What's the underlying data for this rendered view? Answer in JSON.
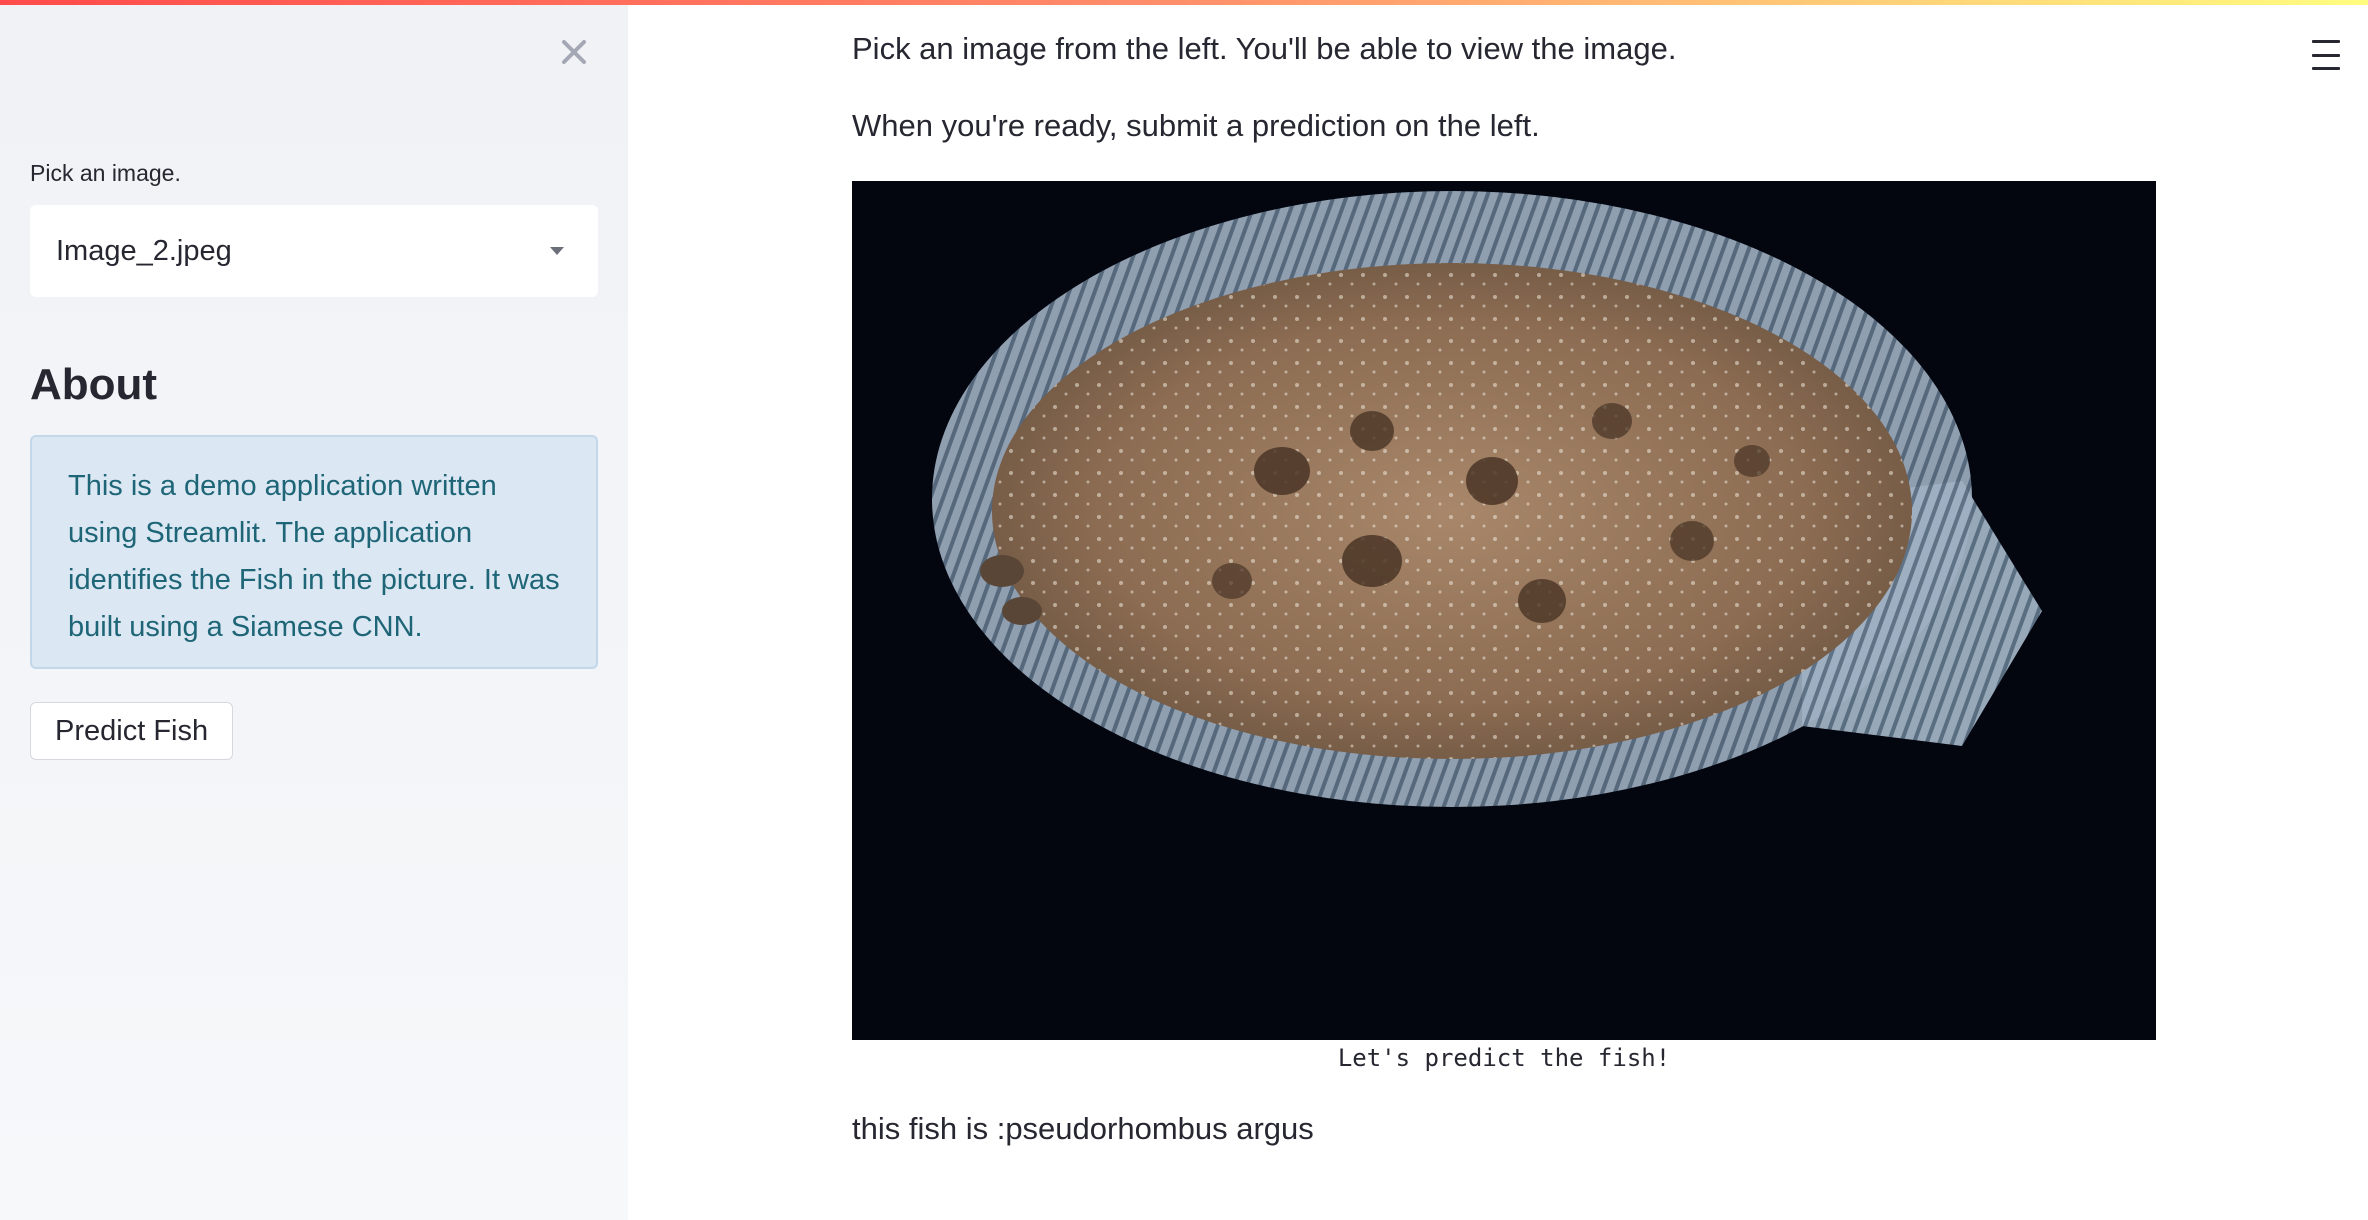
{
  "sidebar": {
    "select_label": "Pick an image.",
    "selected_image": "Image_2.jpeg",
    "about_heading": "About",
    "about_text": "This is a demo application written using Streamlit. The application identifies the Fish in the picture. It was built using a Siamese CNN.",
    "predict_button": "Predict Fish",
    "close_icon": "close-icon"
  },
  "main": {
    "instruction_1": "Pick an image from the left. You'll be able to view the image.",
    "instruction_2": "When you're ready, submit a prediction on the left.",
    "image_caption": "Let's predict the fish!",
    "prediction": "this fish is :pseudorhombus argus",
    "menu_icon": "hamburger-menu-icon"
  },
  "colors": {
    "accent_gradient_start": "#ff4b4b",
    "accent_gradient_end": "#fffd80",
    "info_background": "#dbe7f2",
    "info_text": "#1e6677",
    "sidebar_background": "#f0f2f6"
  }
}
